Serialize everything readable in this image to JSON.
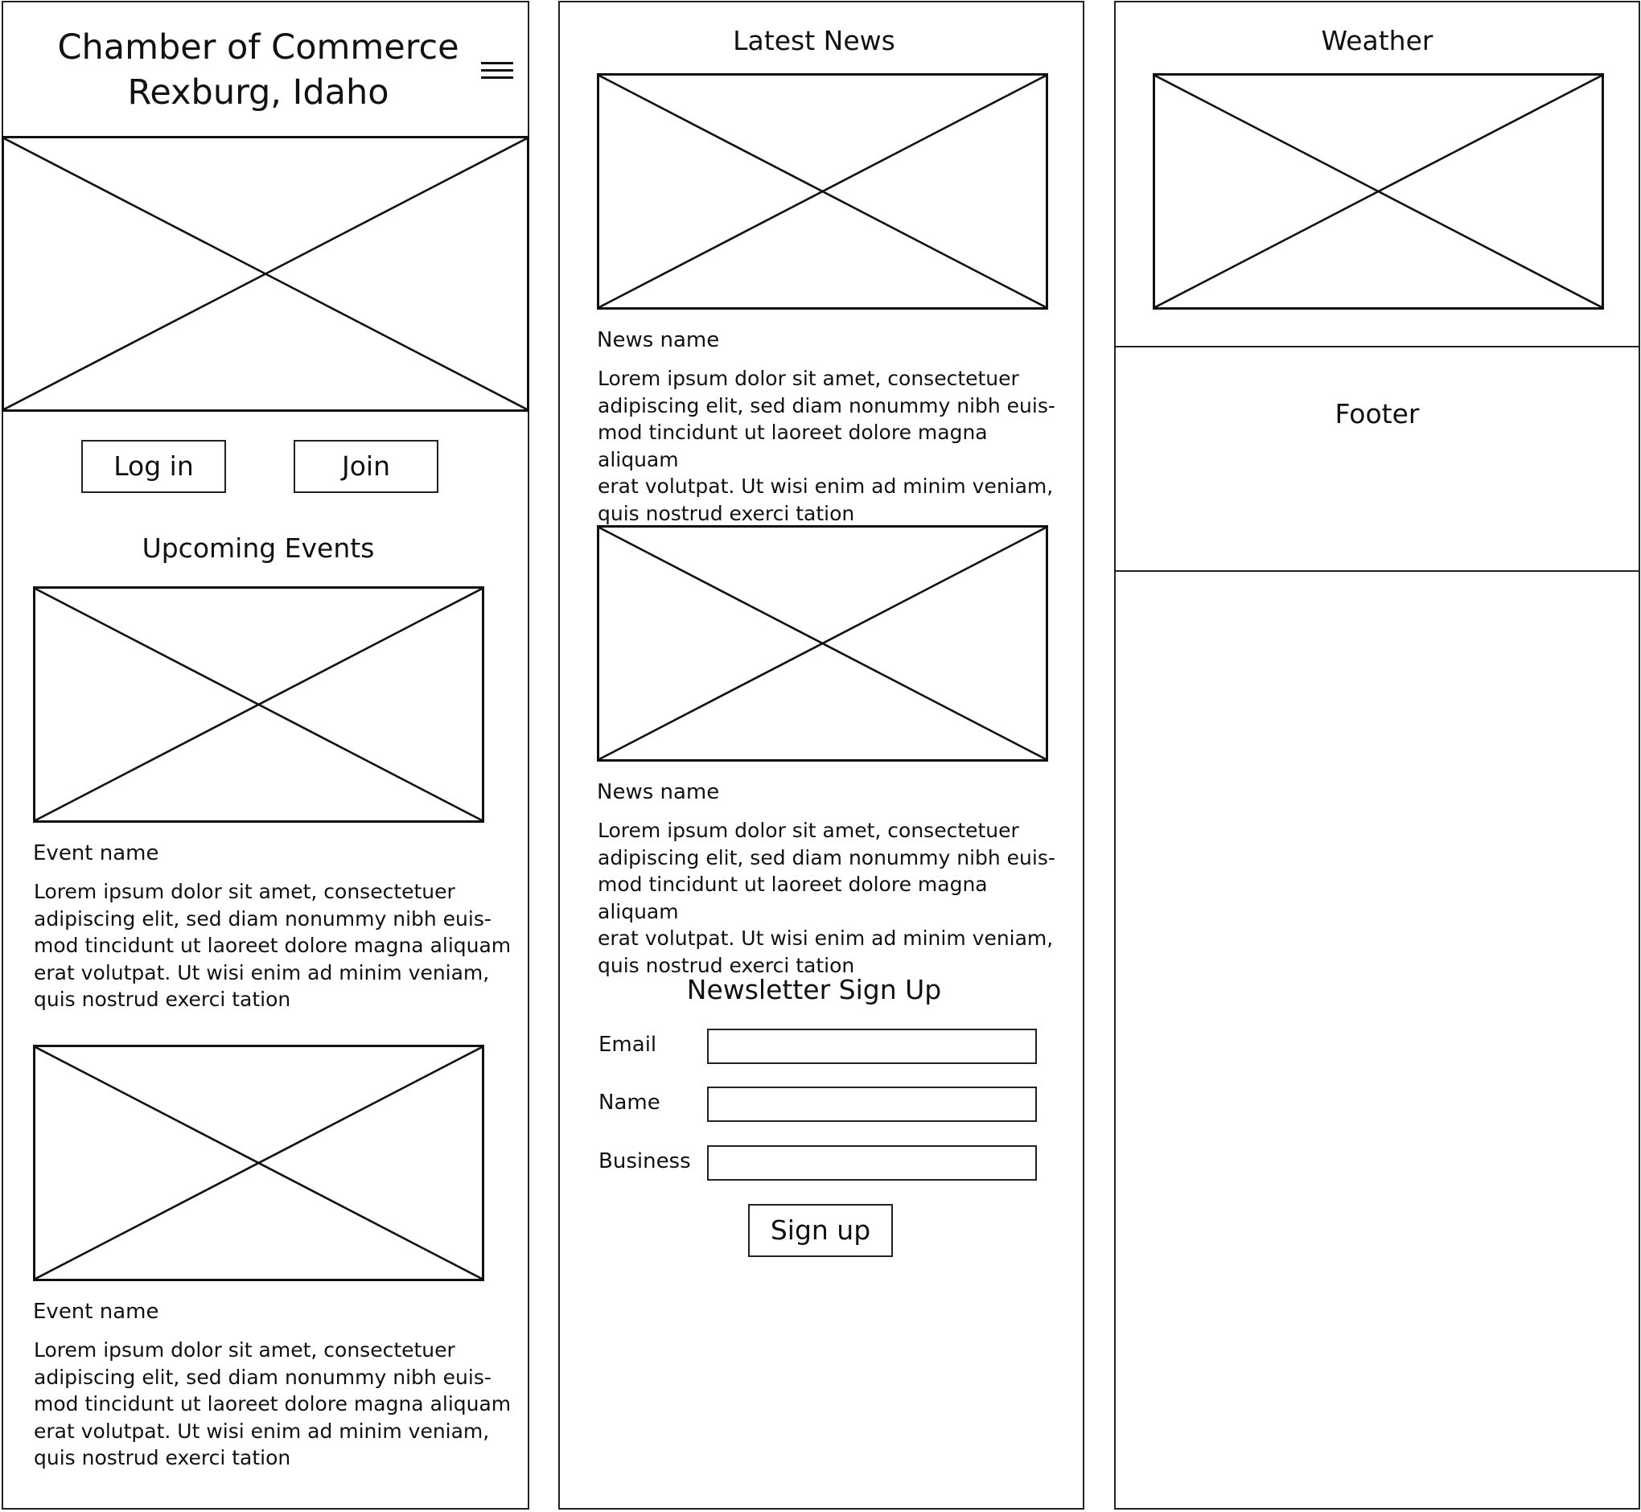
{
  "header": {
    "title_line1": "Chamber of Commerce",
    "title_line2": "Rexburg, Idaho",
    "menu_icon": "hamburger-menu-icon"
  },
  "hero": {
    "icon": "image-placeholder-icon"
  },
  "auth": {
    "login_label": "Log in",
    "join_label": "Join"
  },
  "events": {
    "heading": "Upcoming Events",
    "items": [
      {
        "name": "Event name",
        "text": "Lorem ipsum dolor sit amet, consectetuer\nadipiscing elit, sed diam nonummy nibh euis-\nmod tincidunt ut laoreet dolore magna aliquam\nerat volutpat. Ut wisi enim ad minim veniam,\nquis nostrud exerci tation"
      },
      {
        "name": "Event name",
        "text": "Lorem ipsum dolor sit amet, consectetuer\nadipiscing elit, sed diam nonummy nibh euis-\nmod tincidunt ut laoreet dolore magna aliquam\nerat volutpat. Ut wisi enim ad minim veniam,\nquis nostrud exerci tation"
      }
    ]
  },
  "news": {
    "heading": "Latest News",
    "items": [
      {
        "name": "News name",
        "text": "Lorem ipsum dolor sit amet, consectetuer\nadipiscing elit, sed diam nonummy nibh euis-\nmod tincidunt ut laoreet dolore magna aliquam\nerat volutpat. Ut wisi enim ad minim veniam,\nquis nostrud exerci tation"
      },
      {
        "name": "News name",
        "text": "Lorem ipsum dolor sit amet, consectetuer\nadipiscing elit, sed diam nonummy nibh euis-\nmod tincidunt ut laoreet dolore magna aliquam\nerat volutpat. Ut wisi enim ad minim veniam,\nquis nostrud exerci tation"
      }
    ]
  },
  "newsletter": {
    "heading": "Newsletter Sign Up",
    "email_label": "Email",
    "name_label": "Name",
    "business_label": "Business",
    "email_value": "",
    "name_value": "",
    "business_value": "",
    "signup_label": "Sign up"
  },
  "weather": {
    "heading": "Weather"
  },
  "footer": {
    "label": "Footer"
  },
  "colors": {
    "stroke": "#111111",
    "background": "#ffffff"
  }
}
